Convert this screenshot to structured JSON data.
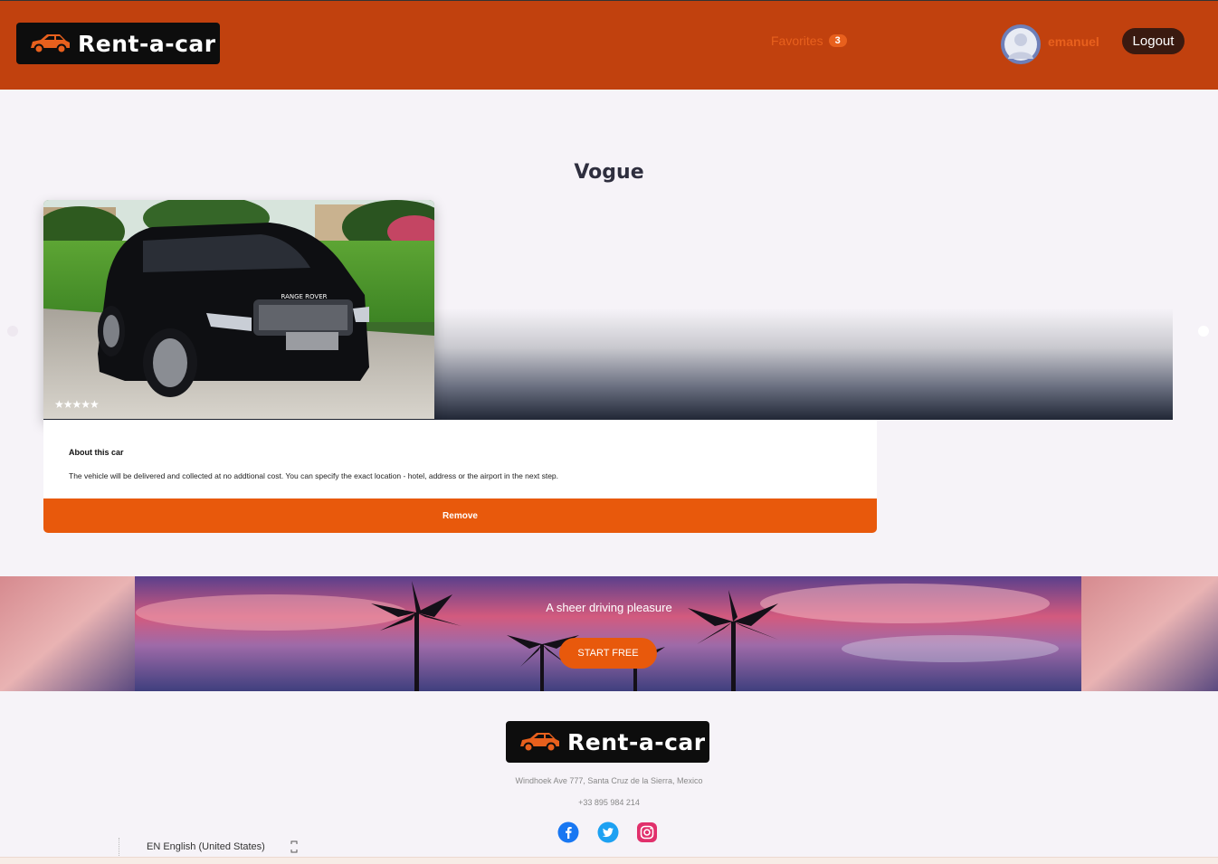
{
  "header": {
    "brand": "Rent-a-car",
    "favorites_label": "Favorites",
    "favorites_count": "3",
    "username": "emanuel",
    "logout_label": "Logout"
  },
  "car": {
    "title": "Vogue",
    "badge": "RANGE ROVER",
    "rating": 5,
    "rating_stars": "★★★★★",
    "about_title": "About this car",
    "about_text": "The vehicle will be delivered and collected at no addtional cost. You can specify the exact location - hotel, address or the airport in the next step.",
    "remove_label": "Remove"
  },
  "banner": {
    "tagline": "A sheer driving pleasure",
    "cta_label": "START FREE"
  },
  "footer": {
    "brand": "Rent-a-car",
    "address": "Windhoek Ave 777, Santa Cruz de la Sierra, Mexico",
    "phone": "+33 895 984 214",
    "language": "EN English (United States)"
  },
  "colors": {
    "header_bg": "#c1410e",
    "accent": "#e8590c",
    "logout_bg": "#3a1a10",
    "page_bg": "#f6f3f8"
  },
  "icons": [
    "car-icon",
    "avatar-icon",
    "star-icon",
    "facebook-icon",
    "twitter-icon",
    "instagram-icon",
    "chevron-left-icon",
    "chevron-right-icon"
  ]
}
